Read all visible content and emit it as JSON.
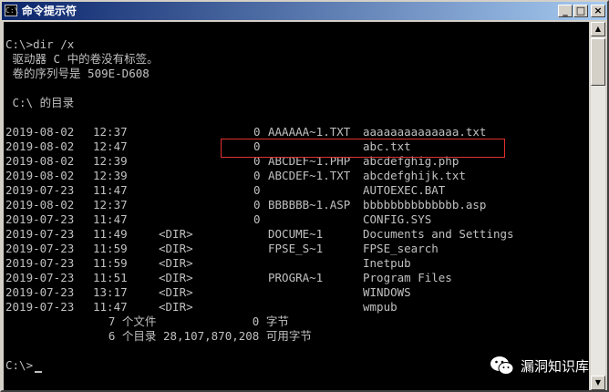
{
  "window": {
    "title": "命令提示符",
    "icon_label": "C:\\",
    "minimize": "_",
    "maximize": "□",
    "close": "×"
  },
  "console": {
    "prompt_line": "C:\\>dir /x",
    "volume_line": " 驱动器 C 中的卷没有标签。",
    "serial_line": " 卷的序列号是 509E-D608",
    "dir_of_line": " C:\\ 的目录",
    "entries": [
      {
        "date": "2019-08-02",
        "time": "12:37",
        "dir": "",
        "size": "0",
        "short": "AAAAAA~1.TXT",
        "name": "aaaaaaaaaaaaaa.txt"
      },
      {
        "date": "2019-08-02",
        "time": "12:47",
        "dir": "",
        "size": "0",
        "short": "",
        "name": "abc.txt"
      },
      {
        "date": "2019-08-02",
        "time": "12:39",
        "dir": "",
        "size": "0",
        "short": "ABCDEF~1.PHP",
        "name": "abcdefghig.php"
      },
      {
        "date": "2019-08-02",
        "time": "12:39",
        "dir": "",
        "size": "0",
        "short": "ABCDEF~1.TXT",
        "name": "abcdefghijk.txt"
      },
      {
        "date": "2019-07-23",
        "time": "11:47",
        "dir": "",
        "size": "0",
        "short": "",
        "name": "AUTOEXEC.BAT"
      },
      {
        "date": "2019-08-02",
        "time": "12:37",
        "dir": "",
        "size": "0",
        "short": "BBBBBB~1.ASP",
        "name": "bbbbbbbbbbbbbb.asp"
      },
      {
        "date": "2019-07-23",
        "time": "11:47",
        "dir": "",
        "size": "0",
        "short": "",
        "name": "CONFIG.SYS"
      },
      {
        "date": "2019-07-23",
        "time": "11:49",
        "dir": "<DIR>",
        "size": "",
        "short": "DOCUME~1",
        "name": "Documents and Settings"
      },
      {
        "date": "2019-07-23",
        "time": "11:59",
        "dir": "<DIR>",
        "size": "",
        "short": "FPSE_S~1",
        "name": "FPSE_search"
      },
      {
        "date": "2019-07-23",
        "time": "11:59",
        "dir": "<DIR>",
        "size": "",
        "short": "",
        "name": "Inetpub"
      },
      {
        "date": "2019-07-23",
        "time": "11:51",
        "dir": "<DIR>",
        "size": "",
        "short": "PROGRA~1",
        "name": "Program Files"
      },
      {
        "date": "2019-07-23",
        "time": "13:17",
        "dir": "<DIR>",
        "size": "",
        "short": "",
        "name": "WINDOWS"
      },
      {
        "date": "2019-07-23",
        "time": "11:47",
        "dir": "<DIR>",
        "size": "",
        "short": "",
        "name": "wmpub"
      }
    ],
    "files_summary": "               7 个文件              0 字节",
    "dirs_summary": "               6 个目录 28,107,870,208 可用字节",
    "final_prompt": "C:\\>",
    "highlight_color": "#e03030"
  },
  "watermark": {
    "text": "漏洞知识库",
    "icon": "wechat-icon"
  }
}
